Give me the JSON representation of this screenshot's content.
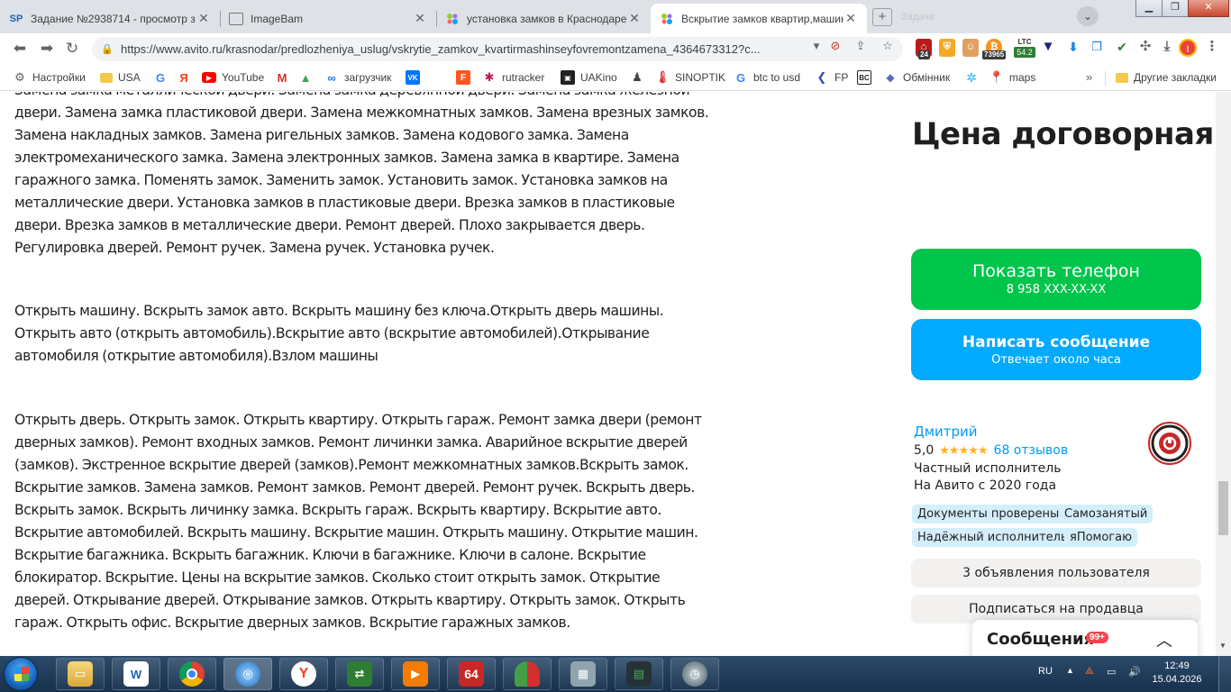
{
  "browser": {
    "tabs": [
      {
        "favicon": "SP",
        "title": "Задание №2938714 - просмотр з"
      },
      {
        "favicon": "page-icon",
        "title": "ImageBam"
      },
      {
        "favicon": "avito-icon",
        "title": "установка замков в Краснодаре -"
      },
      {
        "favicon": "avito-icon",
        "title": "Вскрытие замков квартир,машин"
      }
    ],
    "ghost_tab": "Задачи",
    "url": "https://www.avito.ru/krasnodar/predlozheniya_uslug/vskrytie_zamkov_kvartirmashinseyfovremontzamena_4364673312?c...",
    "extensions": [
      {
        "name": "ext-24",
        "badge": "24",
        "color": "#b71c1c"
      },
      {
        "name": "ext-shield",
        "badge": "",
        "color": "#f9a825"
      },
      {
        "name": "ext-face",
        "badge": "",
        "color": "#e0a060"
      },
      {
        "name": "ext-bitcoin",
        "badge": "73965",
        "color": "#f7931a"
      }
    ],
    "ltc": {
      "label": "LTC",
      "value": "54.2"
    },
    "profile_initial": "I"
  },
  "bookmarks": [
    {
      "label": "Настройки",
      "icon": "gear-icon",
      "color": "#5f6368"
    },
    {
      "label": "USA",
      "icon": "folder-icon",
      "color": "#f2c94c"
    },
    {
      "label": "",
      "icon": "google-icon",
      "color": "#ea4335"
    },
    {
      "label": "",
      "icon": "yandex-icon",
      "color": "#fc3f1d"
    },
    {
      "label": "YouTube",
      "icon": "youtube-icon",
      "color": "#ff0000"
    },
    {
      "label": "",
      "icon": "gmail-icon",
      "color": "#d93025"
    },
    {
      "label": "",
      "icon": "drive-icon",
      "color": "#34a853"
    },
    {
      "label": "загрузчик",
      "icon": "loader-icon",
      "color": "#1a73e8"
    },
    {
      "label": "",
      "icon": "vk-icon",
      "color": "#0077ff"
    },
    {
      "label": "",
      "icon": "f-icon",
      "color": "#ff5722"
    },
    {
      "label": "rutracker",
      "icon": "rutracker-icon",
      "color": "#c2185b"
    },
    {
      "label": "UAKino",
      "icon": "uakino-icon",
      "color": "#212121"
    },
    {
      "label": "",
      "icon": "person-icon",
      "color": "#424242"
    },
    {
      "label": "SINOPTIK",
      "icon": "thermometer-icon",
      "color": "#d32f2f"
    },
    {
      "label": "btc to usd",
      "icon": "google-icon",
      "color": "#4285f4"
    },
    {
      "label": "FP",
      "icon": "fp-icon",
      "color": "#3949ab"
    },
    {
      "label": "",
      "icon": "bc-icon",
      "color": "#212121"
    },
    {
      "label": "Обмінник",
      "icon": "exchange-icon",
      "color": "#5c6bc0"
    },
    {
      "label": "",
      "icon": "snowflake-icon",
      "color": "#29b6f6"
    },
    {
      "label": "maps",
      "icon": "maps-icon",
      "color": "#34a853"
    }
  ],
  "bookmarks_more": "»",
  "other_bookmarks": "Другие закладки",
  "description": {
    "p0": "Замена замка металлической двери. Замена замка деревянной двери. Замена замка железной двери. Замена замка пластиковой двери. Замена межкомнатных замков. Замена врезных замков. Замена накладных замков. Замена ригельных замков. Замена кодового замка. Замена электромеханического замка. Замена электронных замков. Замена замка в квартире. Замена гаражного замка. Поменять замок. Заменить замок. Установить замок. Установка замков на металлические двери. Установка замков в пластиковые двери. Врезка замков в пластиковые двери. Врезка замков в металлические двери. Ремонт дверей. Плохо закрывается дверь. Регулировка дверей. Ремонт ручек. Замена ручек. Установка ручек.",
    "p1": "Открыть машину. Вскрыть замок авто. Вскрыть машину без ключа.Открыть дверь машины. Открыть авто (открыть автомобиль).Вскрытие авто (вскрытие автомобилей).Открывание автомобиля (открытие автомобиля).Взлом машины",
    "p2": "Открыть дверь. Открыть замок. Открыть квартиру. Открыть гараж. Ремонт замка двери (ремонт дверных замков). Ремонт входных замков. Ремонт личинки замка. Аварийное вскрытие дверей (замков). Экстренное вскрытие дверей (замков).Ремонт межкомнатных замков.Вскрыть замок. Вскрытие замков. Замена замков. Ремонт замков. Ремонт дверей. Ремонт ручек. Вскрыть дверь. Вскрыть замок. Вскрыть личинку замка. Вскрыть гараж. Вскрыть квартиру. Вскрытие авто. Вскрытие автомобилей. Вскрыть машину. Вскрытие машин. Открыть машину. Открытие машин. Вскрытие багажника. Вскрыть багажник. Ключи в багажнике. Ключи в салоне. Вскрытие блокиратор. Вскрытие. Цены на вскрытие замков. Сколько стоит открыть замок. Открытие дверей. Открывание дверей. Открывание замков. Открыть квартиру. Открыть замок. Открыть гараж. Открыть офис. Вскрытие дверных замков. Вскрытие гаражных замков."
  },
  "sidebar": {
    "price": "Цена договорная",
    "phone_button": {
      "label": "Показать телефон",
      "sub": "8 958 XXX-XX-XX"
    },
    "message_button": {
      "label": "Написать сообщение",
      "sub": "Отвечает около часа"
    },
    "seller": {
      "name": "Дмитрий",
      "rating": "5,0",
      "stars": "★★★★★",
      "reviews": "68 отзывов",
      "type": "Частный исполнитель",
      "since": "На Авито с 2020 года"
    },
    "badges": [
      "Документы проверены",
      "Самозанятый",
      "Надёжный исполнитель",
      "яПомогаю"
    ],
    "ads_button": "3 объявления пользователя",
    "subscribe_button": "Подписаться на продавца",
    "messages": {
      "label": "Сообщения",
      "count": "99+"
    }
  },
  "taskbar": {
    "lang": "RU",
    "time": "12:49",
    "date": "15.04.2026",
    "app_64": "64"
  },
  "colors": {
    "green": "#00c54c",
    "blue": "#00aaff",
    "link": "#0099f7",
    "badge": "#d4eefc"
  }
}
